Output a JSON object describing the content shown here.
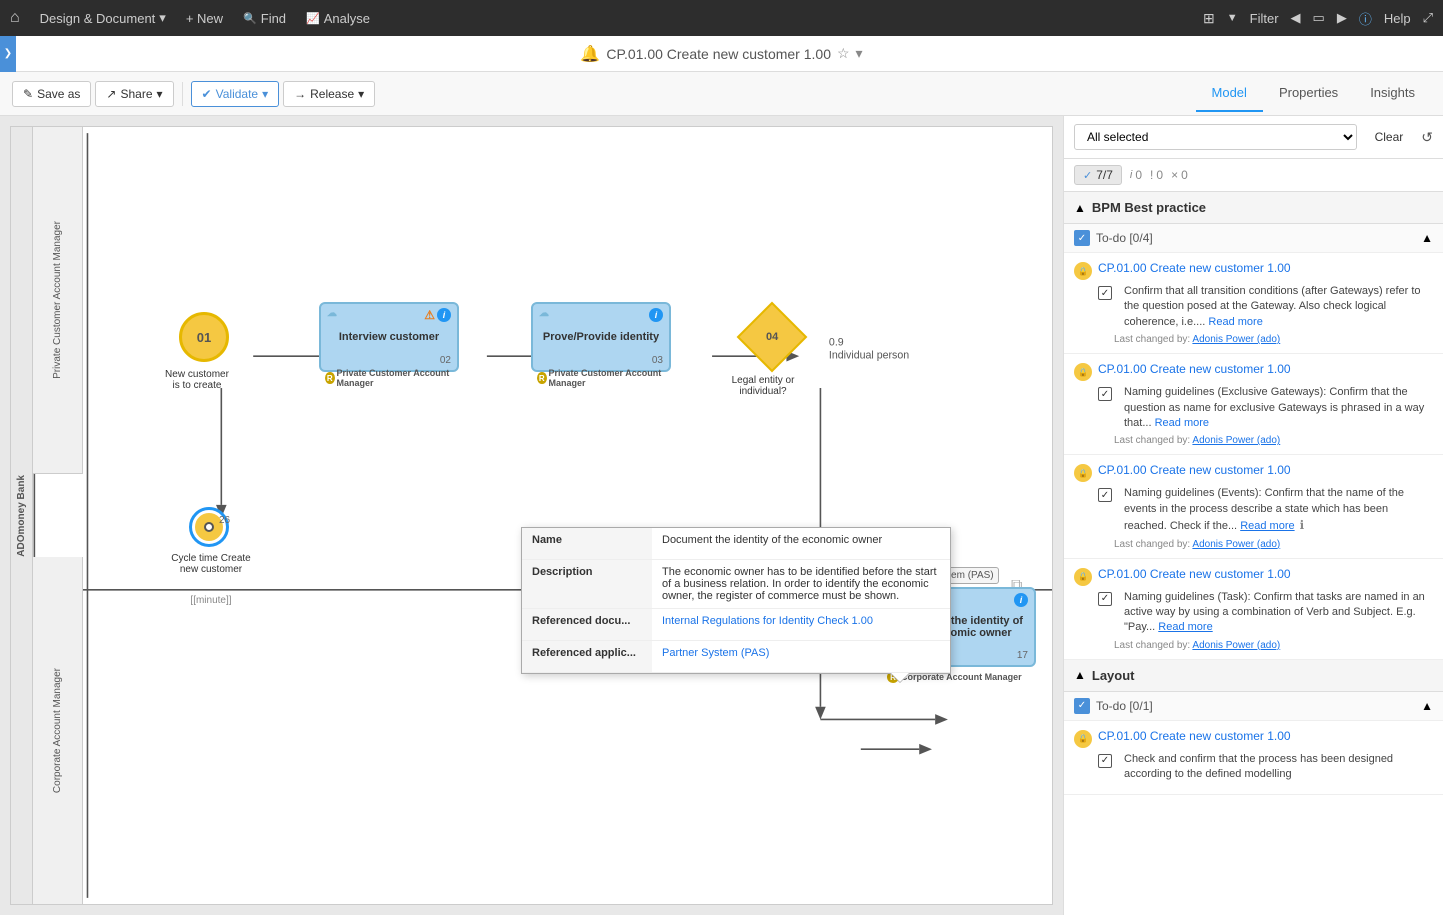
{
  "topNav": {
    "homeIcon": "⌂",
    "designLabel": "Design & Document",
    "newLabel": "+ New",
    "findLabel": "Find",
    "analyseLabel": "Analyse",
    "filterLabel": "Filter",
    "helpLabel": "Help"
  },
  "titleBar": {
    "icon": "🔔",
    "title": "CP.01.00 Create new customer 1.00",
    "starIcon": "☆",
    "dropdownIcon": "▾",
    "toggleArrow": "❯"
  },
  "toolbar": {
    "saveAsLabel": "Save as",
    "shareLabel": "Share",
    "validateLabel": "Validate",
    "releaseLabel": "Release",
    "modelTab": "Model",
    "propertiesTab": "Properties",
    "insightsTab": "Insights"
  },
  "canvas": {
    "outerLabel": "ADOmoney Bank",
    "lanes": [
      {
        "id": "private",
        "label": "Private Customer Account Manager",
        "elements": []
      },
      {
        "id": "corporate",
        "label": "Corporate Account Manager",
        "elements": []
      }
    ],
    "startEvent": {
      "id": "01",
      "label": "New customer is to create"
    },
    "tasks": [
      {
        "id": "02",
        "label": "Interview customer",
        "role": "Private Customer Account Manager",
        "hasInfo": true,
        "hasWarning": true
      },
      {
        "id": "03",
        "label": "Prove/Provide identity",
        "role": "Private Customer Account Manager",
        "hasInfo": true
      },
      {
        "id": "17",
        "label": "Document the identity of the economic owner",
        "role": "Corporate Account Manager",
        "system": "Partner System (PAS)",
        "hasInfo": true
      }
    ],
    "gateway": {
      "id": "04",
      "label": "Legal entity or individual?"
    },
    "intEvent": {
      "id": "26",
      "label": "Cycle time Create new customer",
      "unit": "[[minute]]"
    },
    "connections": [
      {
        "from": "01",
        "to": "02",
        "label": ""
      },
      {
        "from": "02",
        "to": "03",
        "label": ""
      },
      {
        "from": "03",
        "to": "04",
        "label": ""
      },
      {
        "from": "04",
        "to": "ind",
        "label": "0.9 Individual person"
      }
    ],
    "tooltip": {
      "name": {
        "key": "Name",
        "value": "Document the identity of the economic owner"
      },
      "description": {
        "key": "Description",
        "value": "The economic owner has to be identified before the start of a business relation. In order to identify the economic owner, the register of commerce must be shown."
      },
      "referencedDoc": {
        "key": "Referenced docu...",
        "value": "Internal Regulations for Identity Check 1.00"
      },
      "referencedApp": {
        "key": "Referenced applic...",
        "value": "Partner System (PAS)"
      }
    }
  },
  "rightPanel": {
    "selectValue": "All selected",
    "clearLabel": "Clear",
    "refreshIcon": "↺",
    "countBadge": "7/7",
    "infoCount": "i 0",
    "warningCount": "! 0",
    "errorCount": "× 0",
    "sectionTitle": "BPM Best practice",
    "subsection1": {
      "label": "To-do [0/4]",
      "items": [
        {
          "title": "CP.01.00 Create new customer 1.00",
          "body": "Confirm that all transition conditions (after Gateways) refer to the question posed at the Gateway. Also check logical coherence, i.e....",
          "readMore": "Read more",
          "changedBy": "Adonis Power (ado)"
        },
        {
          "title": "CP.01.00 Create new customer 1.00",
          "body": "Naming guidelines (Exclusive Gateways): Confirm that the question as name for exclusive Gateways is phrased in a way that...",
          "readMore": "Read more",
          "changedBy": "Adonis Power (ado)"
        },
        {
          "title": "CP.01.00 Create new customer 1.00",
          "body": "Naming guidelines (Events): Confirm that the name of the events in the process describe a state which has been reached. Check if the...",
          "readMore": "Read more",
          "changedBy": "Adonis Power (ado)"
        },
        {
          "title": "CP.01.00 Create new customer 1.00",
          "body": "Naming guidelines (Task): Confirm that tasks are named in an active way by using a combination of Verb and Subject. E.g. \"Pay...",
          "readMore": "Read more",
          "changedBy": "Adonis Power (ado)"
        }
      ]
    },
    "section2": {
      "label": "Layout",
      "subsection": {
        "label": "To-do [0/1]",
        "items": [
          {
            "title": "CP.01.00 Create new customer 1.00",
            "body": "Check and confirm that the process has been designed according to the defined modelling",
            "changedBy": ""
          }
        ]
      }
    }
  }
}
